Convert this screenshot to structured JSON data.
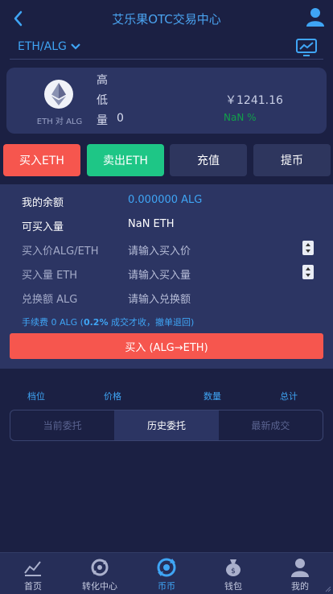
{
  "header": {
    "title": "艾乐果OTC交易中心"
  },
  "pair": {
    "label": "ETH/ALG"
  },
  "ticker": {
    "coin_label": "ETH 对 ALG",
    "high_label": "高",
    "low_label": "低",
    "volume_label": "量",
    "volume_value": "0",
    "price": "￥1241.16",
    "change": "NaN %"
  },
  "actions": {
    "buy": "买入ETH",
    "sell": "卖出ETH",
    "deposit": "充值",
    "withdraw": "提币"
  },
  "form": {
    "balance_label": "我的余额",
    "balance_value": "0.000000  ALG",
    "buyable_label": "可买入量",
    "buyable_value": "NaN  ETH",
    "price_label": "买入价ALG/ETH",
    "price_placeholder": "请输入买入价",
    "amount_label": "买入量 ETH",
    "amount_placeholder": "请输入买入量",
    "exchange_label": "兑换额 ALG",
    "exchange_placeholder": "请输入兑换额",
    "fee_prefix": "手续费 0  ALG (",
    "fee_rate": "0.2%",
    "fee_suffix": " 成交才收，撤单退回)",
    "submit": "买入 (ALG→ETH)"
  },
  "orderbook": {
    "col_level": "档位",
    "col_price": "价格",
    "col_amount": "数量",
    "col_total": "总计"
  },
  "tabs": [
    "当前委托",
    "历史委托",
    "最新成交"
  ],
  "active_tab": 1,
  "bottom_nav": [
    {
      "label": "首页",
      "icon": "chart-icon"
    },
    {
      "label": "转化中心",
      "icon": "convert-icon"
    },
    {
      "label": "币币",
      "icon": "exchange-icon"
    },
    {
      "label": "钱包",
      "icon": "wallet-icon"
    },
    {
      "label": "我的",
      "icon": "user-icon"
    }
  ],
  "colors": {
    "accent": "#3fa5f5",
    "buy": "#f6564e",
    "sell": "#1ec686",
    "panel": "#2c3563",
    "background": "#1b2043"
  }
}
